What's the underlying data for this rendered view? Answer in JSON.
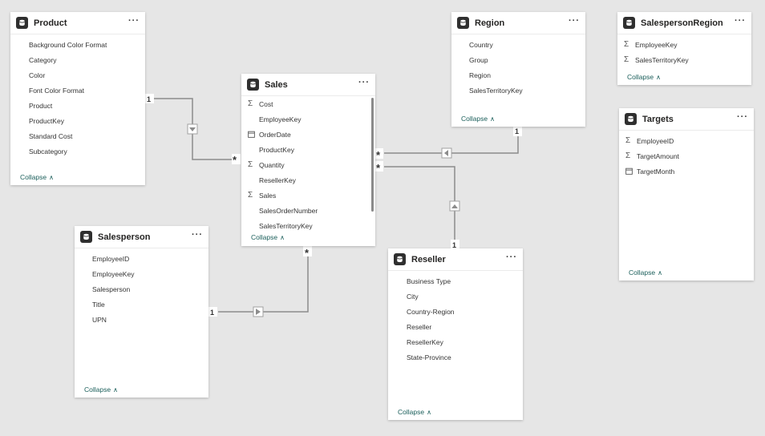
{
  "tables": {
    "product": {
      "title": "Product",
      "fields": [
        "Background Color Format",
        "Category",
        "Color",
        "Font Color Format",
        "Product",
        "ProductKey",
        "Standard Cost",
        "Subcategory"
      ],
      "collapse": "Collapse"
    },
    "sales": {
      "title": "Sales",
      "fields": [
        "Cost",
        "EmployeeKey",
        "OrderDate",
        "ProductKey",
        "Quantity",
        "ResellerKey",
        "Sales",
        "SalesOrderNumber",
        "SalesTerritoryKey"
      ],
      "collapse": "Collapse"
    },
    "region": {
      "title": "Region",
      "fields": [
        "Country",
        "Group",
        "Region",
        "SalesTerritoryKey"
      ],
      "collapse": "Collapse"
    },
    "salesperson_region": {
      "title": "SalespersonRegion",
      "fields": [
        "EmployeeKey",
        "SalesTerritoryKey"
      ],
      "collapse": "Collapse"
    },
    "targets": {
      "title": "Targets",
      "fields": [
        "EmployeeID",
        "TargetAmount",
        "TargetMonth"
      ],
      "collapse": "Collapse"
    },
    "salesperson": {
      "title": "Salesperson",
      "fields": [
        "EmployeeID",
        "EmployeeKey",
        "Salesperson",
        "Title",
        "UPN"
      ],
      "collapse": "Collapse"
    },
    "reseller": {
      "title": "Reseller",
      "fields": [
        "Business Type",
        "City",
        "Country-Region",
        "Reseller",
        "ResellerKey",
        "State-Province"
      ],
      "collapse": "Collapse"
    }
  },
  "more_glyph": "···",
  "cardinality": {
    "one": "1",
    "many": "*"
  },
  "icons": {
    "table": "table-icon",
    "sum": "sigma-icon",
    "calendar": "calendar-icon",
    "more": "more-options-icon",
    "collapse": "chevron-up-icon",
    "filter_direction": "arrow-triangle-icon"
  }
}
